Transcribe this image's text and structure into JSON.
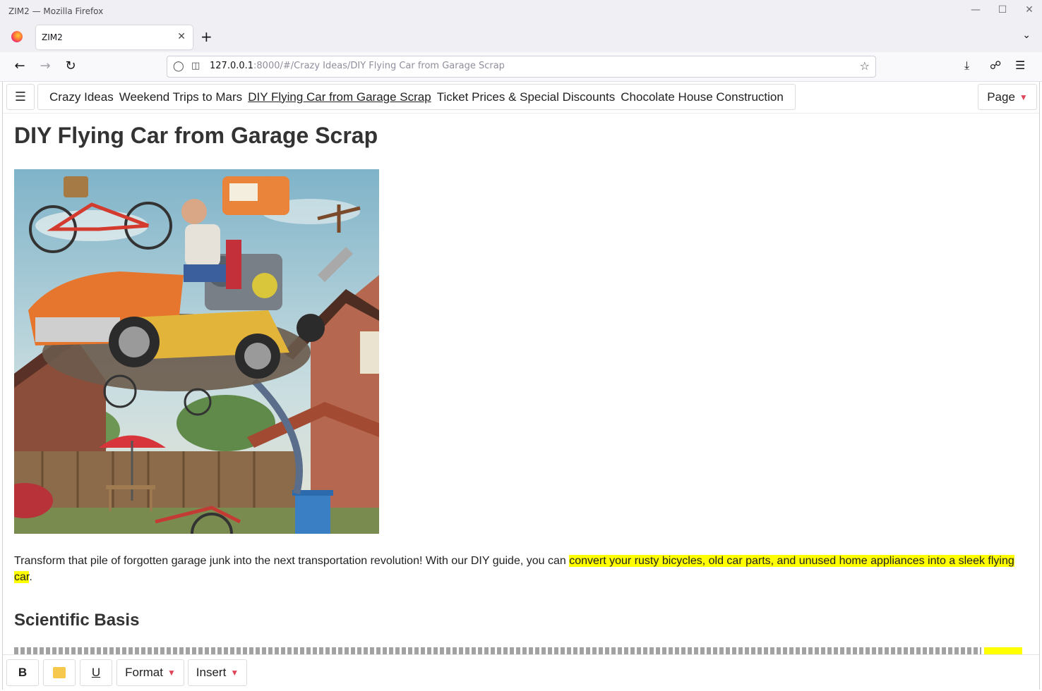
{
  "window": {
    "title": "ZIM2 — Mozilla Firefox",
    "controls": [
      "minimize-icon",
      "maximize-icon",
      "close-icon"
    ]
  },
  "tabs": [
    {
      "label": "ZIM2",
      "active": true
    }
  ],
  "browser": {
    "url_host": "127.0.0.1",
    "url_path": ":8000/#/Crazy Ideas/DIY Flying Car from Garage Scrap"
  },
  "app": {
    "menu_icon": "☰",
    "breadcrumbs": [
      "Crazy Ideas",
      "Weekend Trips to Mars",
      "DIY Flying Car from Garage Scrap",
      "Ticket Prices & Special Discounts",
      "Chocolate House Construction"
    ],
    "active_crumb_index": 2,
    "page_menu_label": "Page"
  },
  "article": {
    "title": "DIY Flying Car from Garage Scrap",
    "intro_plain": "Transform that pile of forgotten garage junk into the next transportation revolution! With our DIY guide, you can ",
    "intro_highlight": "convert your rusty bicycles, old car parts, and unused home appliances into a sleek flying car",
    "intro_end": ".",
    "section_heading": "Scientific Basis",
    "highlight_color": "#ffff00"
  },
  "toolbar": {
    "bold_label": "B",
    "underline_label": "U",
    "format_label": "Format",
    "insert_label": "Insert",
    "highlight_swatch": "#f6c94e"
  }
}
